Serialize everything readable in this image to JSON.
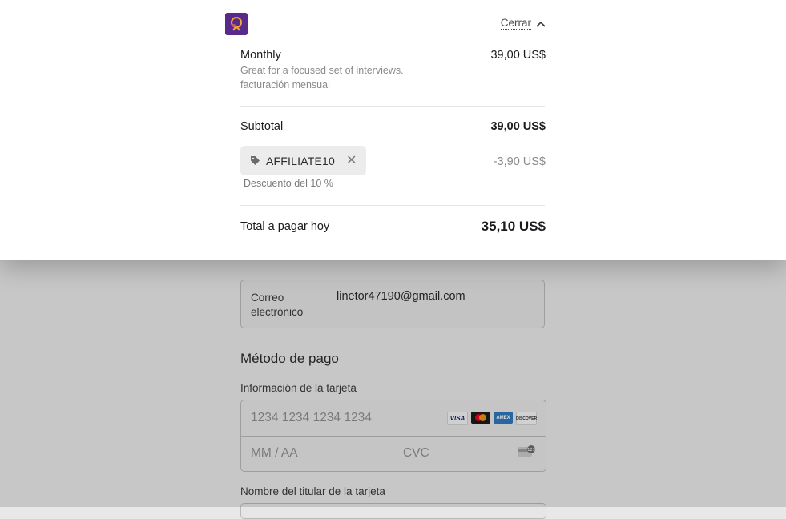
{
  "header": {
    "close_label": "Cerrar"
  },
  "summary": {
    "plan_name": "Monthly",
    "plan_price": "39,00 US$",
    "plan_description": "Great for a focused set of interviews.",
    "plan_billing": "facturación mensual",
    "subtotal_label": "Subtotal",
    "subtotal_value": "39,00 US$",
    "promo_code": "AFFILIATE10",
    "promo_discount_value": "-3,90 US$",
    "promo_note": "Descuento del 10 %",
    "total_label": "Total a pagar hoy",
    "total_value": "35,10 US$"
  },
  "form": {
    "email_label": "Correo electrónico",
    "email_value": "linetor47190@gmail.com",
    "payment_title": "Método de pago",
    "card_info_label": "Información de la tarjeta",
    "card_number_placeholder": "1234 1234 1234 1234",
    "expiry_placeholder": "MM / AA",
    "cvc_placeholder": "CVC",
    "cardholder_label": "Nombre del titular de la tarjeta",
    "card_brands": [
      "VISA",
      "mastercard",
      "AMEX",
      "DISCOVER"
    ]
  },
  "colors": {
    "brand_logo": "#5a2a8a",
    "overlay": "rgba(0,0,0,0.14)"
  }
}
